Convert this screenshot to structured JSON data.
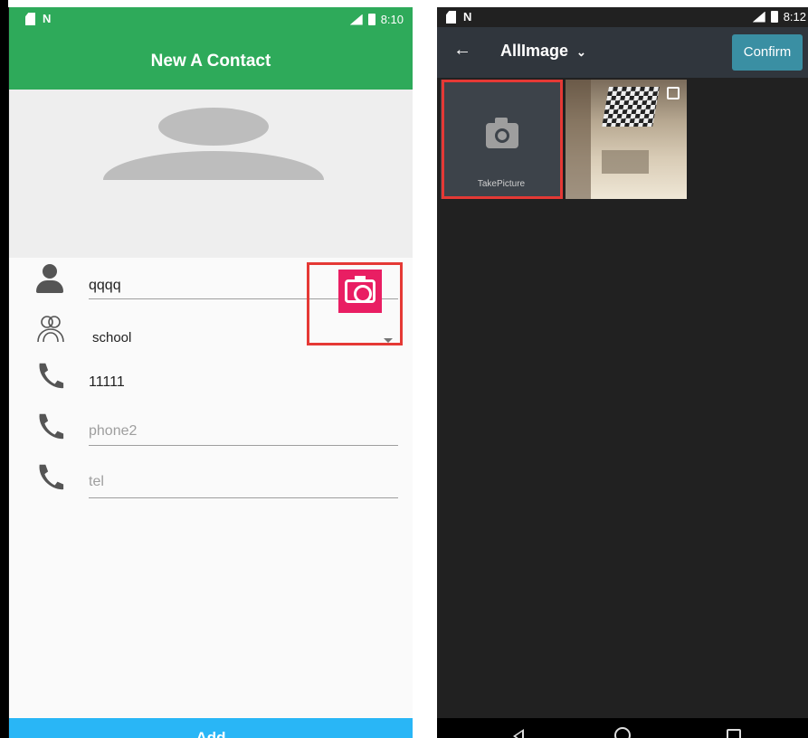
{
  "left_screen": {
    "status_bar": {
      "time": "8:10"
    },
    "app_bar": {
      "title": "New A Contact"
    },
    "form": {
      "name_value": "qqqq",
      "group_value": "school",
      "phone1_value": "11111",
      "phone2_placeholder": "phone2",
      "tel_placeholder": "tel"
    },
    "add_button_label": "Add",
    "colors": {
      "primary": "#2eaa5a",
      "accent": "#e91e63",
      "button": "#29b6f6",
      "highlight": "#e53935"
    }
  },
  "right_screen": {
    "status_bar": {
      "time": "8:12"
    },
    "app_bar": {
      "album_title": "AllImage",
      "confirm_label": "Confirm"
    },
    "take_picture_label": "TakePicture",
    "colors": {
      "bar": "#30363d",
      "confirm": "#3a8fa3",
      "background": "#212121"
    }
  }
}
